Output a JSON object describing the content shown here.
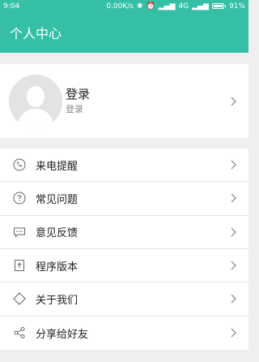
{
  "status_bar": {
    "time": "9:04",
    "speed": "0.00K/s",
    "network": "4G",
    "battery": "91%",
    "battery_level": 0.91
  },
  "header": {
    "title": "个人中心"
  },
  "profile": {
    "name": "登录",
    "subtitle": "登录"
  },
  "menu": {
    "items": [
      {
        "label": "来电提醒",
        "icon": "phone-icon"
      },
      {
        "label": "常见问题",
        "icon": "question-icon"
      },
      {
        "label": "意见反馈",
        "icon": "feedback-icon"
      },
      {
        "label": "程序版本",
        "icon": "version-icon"
      },
      {
        "label": "关于我们",
        "icon": "diamond-icon"
      },
      {
        "label": "分享给好友",
        "icon": "share-icon"
      }
    ]
  },
  "colors": {
    "accent": "#35c0a6",
    "background": "#efefef",
    "text": "#222222",
    "subtext": "#8a8a8a"
  }
}
